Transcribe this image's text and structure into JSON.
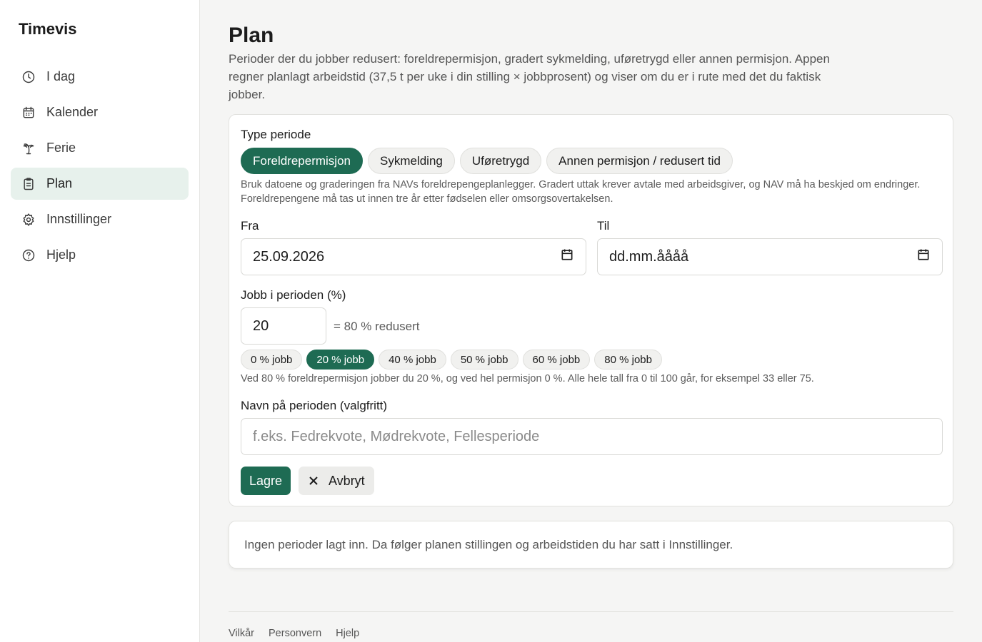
{
  "app": {
    "name": "Timevis"
  },
  "sidebar": {
    "items": [
      {
        "label": "I dag",
        "icon": "clock-icon",
        "active": false
      },
      {
        "label": "Kalender",
        "icon": "calendar-icon",
        "active": false
      },
      {
        "label": "Ferie",
        "icon": "palm-tree-icon",
        "active": false
      },
      {
        "label": "Plan",
        "icon": "clipboard-icon",
        "active": true
      },
      {
        "label": "Innstillinger",
        "icon": "gear-icon",
        "active": false
      },
      {
        "label": "Hjelp",
        "icon": "help-circle-icon",
        "active": false
      }
    ]
  },
  "page": {
    "title": "Plan",
    "intro": "Perioder der du jobber redusert: foreldrepermisjon, gradert sykmelding, uføretrygd eller annen permisjon. Appen regner planlagt arbeidstid (37,5 t per uke i din stilling × jobbprosent) og viser om du er i rute med det du faktisk jobber."
  },
  "form": {
    "type_label": "Type periode",
    "types": [
      "Foreldrepermisjon",
      "Sykmelding",
      "Uføretrygd",
      "Annen permisjon / redusert tid"
    ],
    "type_hint": "Bruk datoene og graderingen fra NAVs foreldrepengeplanlegger. Gradert uttak krever avtale med arbeidsgiver, og NAV må ha beskjed om endringer. Foreldrepengene må tas ut innen tre år etter fødselen eller omsorgsovertakelsen.",
    "from_label": "Fra",
    "from_value": "25.09.2026",
    "to_label": "Til",
    "to_value": "dd.mm.åååå",
    "job_label": "Jobb i perioden (%)",
    "job_value": "20",
    "reduced_text": "= 80 % redusert",
    "presets": [
      "0 % jobb",
      "20 % jobb",
      "40 % jobb",
      "50 % jobb",
      "60 % jobb",
      "80 % jobb"
    ],
    "preset_hint": "Ved 80 % foreldrepermisjon jobber du 20 %, og ved hel permisjon 0 %. Alle hele tall fra 0 til 100 går, for eksempel 33 eller 75.",
    "name_label": "Navn på perioden (valgfritt)",
    "name_placeholder": "f.eks. Fedrekvote, Mødrekvote, Fellesperiode",
    "save_label": "Lagre",
    "cancel_label": "Avbryt"
  },
  "empty_state": "Ingen perioder lagt inn. Da følger planen stillingen og arbeidstiden du har satt i Innstillinger.",
  "footer": {
    "links": [
      "Vilkår",
      "Personvern",
      "Hjelp"
    ]
  },
  "colors": {
    "accent": "#1e6b53",
    "active_nav_bg": "#e7f1ec"
  }
}
